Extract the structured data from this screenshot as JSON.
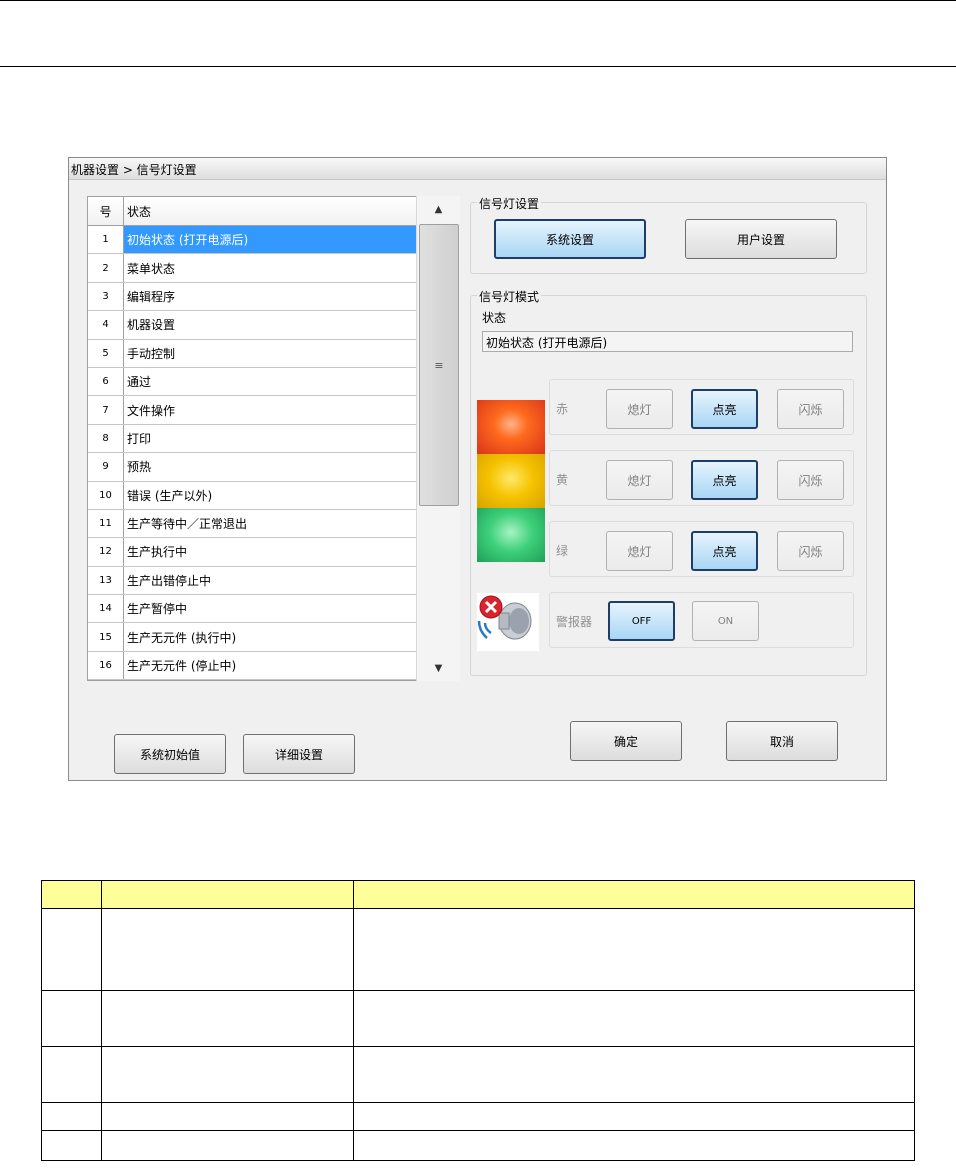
{
  "dialog": {
    "breadcrumb": "机器设置 > 信号灯设置"
  },
  "list": {
    "header_num": "号",
    "header_state": "状态",
    "rows": [
      {
        "num": "1",
        "state": "初始状态 (打开电源后)"
      },
      {
        "num": "2",
        "state": "菜单状态"
      },
      {
        "num": "3",
        "state": "编辑程序"
      },
      {
        "num": "4",
        "state": "机器设置"
      },
      {
        "num": "5",
        "state": "手动控制"
      },
      {
        "num": "6",
        "state": "通过"
      },
      {
        "num": "7",
        "state": "文件操作"
      },
      {
        "num": "8",
        "state": "打印"
      },
      {
        "num": "9",
        "state": "预热"
      },
      {
        "num": "10",
        "state": "错误 (生产以外)"
      },
      {
        "num": "11",
        "state": "生产等待中／正常退出"
      },
      {
        "num": "12",
        "state": "生产执行中"
      },
      {
        "num": "13",
        "state": "生产出错停止中"
      },
      {
        "num": "14",
        "state": "生产暂停中"
      },
      {
        "num": "15",
        "state": "生产无元件 (执行中)"
      },
      {
        "num": "16",
        "state": "生产无元件 (停止中)"
      }
    ],
    "scroll_up": "▲",
    "scroll_down": "▼",
    "scroll_grip": "≡"
  },
  "signal_settings": {
    "title": "信号灯设置",
    "system_button": "系统设置",
    "user_button": "用户设置"
  },
  "signal_mode": {
    "title": "信号灯模式",
    "status_label": "状态",
    "status_value": "初始状态 (打开电源后)",
    "lamps": [
      {
        "label": "赤",
        "off": "熄灯",
        "on": "点亮",
        "blink": "闪烁"
      },
      {
        "label": "黄",
        "off": "熄灯",
        "on": "点亮",
        "blink": "闪烁"
      },
      {
        "label": "绿",
        "off": "熄灯",
        "on": "点亮",
        "blink": "闪烁"
      }
    ],
    "buzzer": {
      "label": "警报器",
      "off": "OFF",
      "on": "ON"
    }
  },
  "footer": {
    "system_default": "系统初始值",
    "detail_settings": "详细设置",
    "ok": "确定",
    "cancel": "取消"
  },
  "colors": {
    "selection": "#3399ff",
    "active_button": "#a9d6f5",
    "table_header": "#ffff99"
  }
}
